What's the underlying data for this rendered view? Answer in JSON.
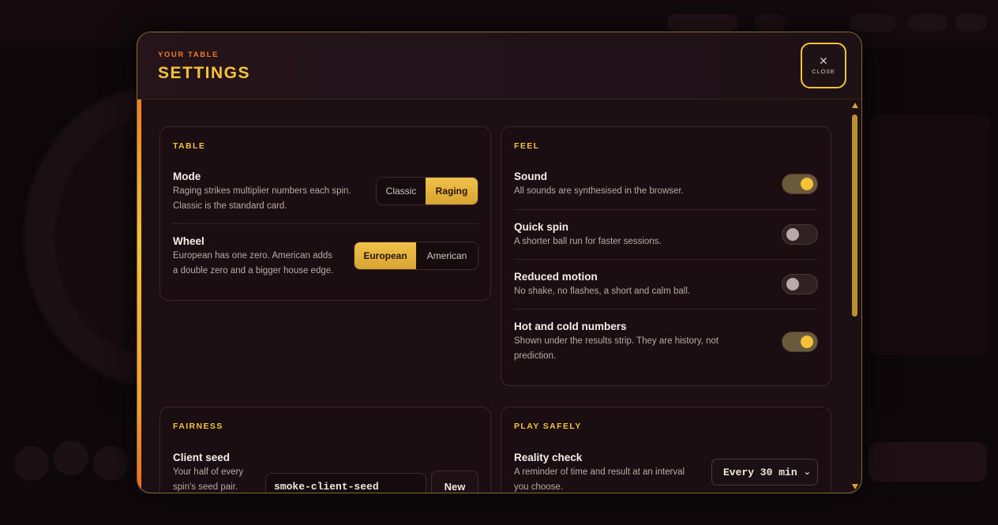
{
  "modal": {
    "eyebrow": "YOUR TABLE",
    "title": "SETTINGS",
    "close_label": "CLOSE"
  },
  "table_card": {
    "title": "TABLE",
    "mode": {
      "label": "Mode",
      "desc_line1": "Raging strikes multiplier numbers each spin.",
      "desc_line2": "Classic is the standard card.",
      "options": [
        "Classic",
        "Raging"
      ],
      "selected": "Raging"
    },
    "wheel": {
      "label": "Wheel",
      "desc_line1": "European has one zero. American adds",
      "desc_line2": "a double zero and a bigger house edge.",
      "options": [
        "European",
        "American"
      ],
      "selected": "European"
    }
  },
  "feel_card": {
    "title": "FEEL",
    "sound": {
      "label": "Sound",
      "desc": "All sounds are synthesised in the browser.",
      "on": true
    },
    "quick_spin": {
      "label": "Quick spin",
      "desc": "A shorter ball run for faster sessions.",
      "on": false
    },
    "reduced_motion": {
      "label": "Reduced motion",
      "desc": "No shake, no flashes, a short and calm ball.",
      "on": false
    },
    "hot_cold": {
      "label": "Hot and cold numbers",
      "desc_line1": "Shown under the results strip. They are history, not",
      "desc_line2": "prediction.",
      "on": true
    }
  },
  "fairness_card": {
    "title": "FAIRNESS",
    "client_seed": {
      "label": "Client seed",
      "desc_line1": "Your half of every",
      "desc_line2": "spin's seed pair.",
      "value": "smoke-client-seed",
      "new_label": "New"
    }
  },
  "play_safely_card": {
    "title": "PLAY SAFELY",
    "reality_check": {
      "label": "Reality check",
      "desc_line1": "A reminder of time and result at an interval",
      "desc_line2": "you choose.",
      "selected": "Every 30 min"
    }
  },
  "colors": {
    "accent": "#f5c23a",
    "eyebrow": "#f07a2a",
    "background": "#1c1014"
  }
}
